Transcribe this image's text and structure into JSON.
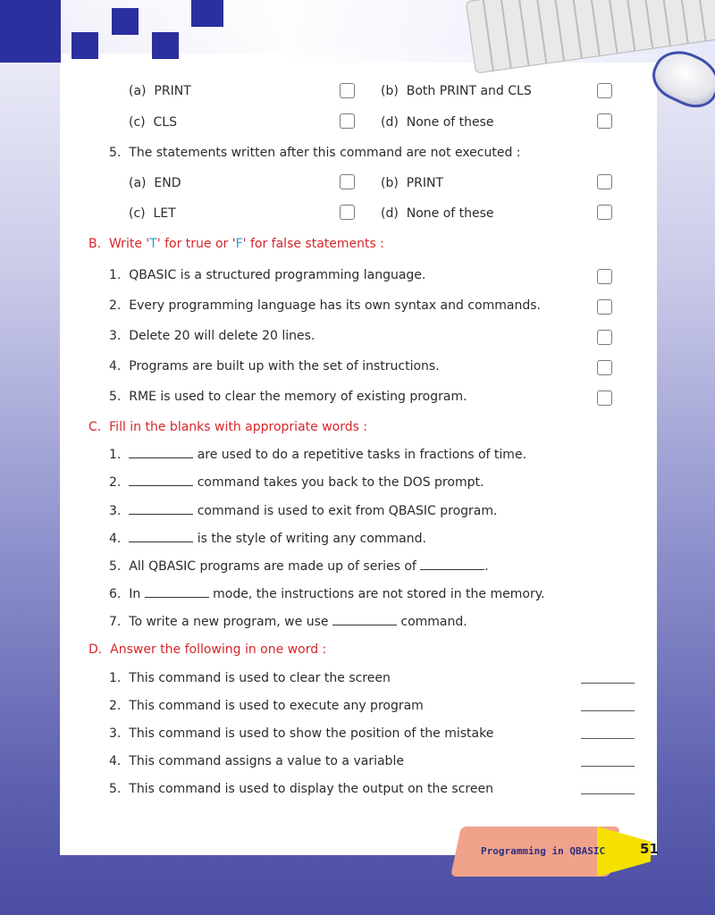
{
  "q4_options": [
    {
      "label": "(a)",
      "text": "PRINT"
    },
    {
      "label": "(b)",
      "text": "Both PRINT and CLS"
    },
    {
      "label": "(c)",
      "text": "CLS"
    },
    {
      "label": "(d)",
      "text": "None of these"
    }
  ],
  "q5": {
    "number": "5.",
    "text": "The statements written after this command are not executed :",
    "options": [
      {
        "label": "(a)",
        "text": "END"
      },
      {
        "label": "(b)",
        "text": "PRINT"
      },
      {
        "label": "(c)",
        "text": "LET"
      },
      {
        "label": "(d)",
        "text": "None of these"
      }
    ]
  },
  "section_b": {
    "letter": "B.",
    "title_pre": "Write '",
    "t": "T",
    "title_mid": "' for true or '",
    "f": "F",
    "title_post": "' for false statements :",
    "items": [
      {
        "num": "1.",
        "text": "QBASIC is a structured programming language."
      },
      {
        "num": "2.",
        "text": "Every programming language has its own syntax and commands."
      },
      {
        "num": "3.",
        "text": "Delete 20 will delete 20 lines."
      },
      {
        "num": "4.",
        "text": "Programs are built up with the set of instructions."
      },
      {
        "num": "5.",
        "text": "RME is used to clear the memory of existing program."
      }
    ]
  },
  "section_c": {
    "letter": "C.",
    "title": "Fill in the blanks with appropriate words :",
    "items": [
      {
        "num": "1.",
        "before": "",
        "after": " are used to do a repetitive tasks in fractions of time."
      },
      {
        "num": "2.",
        "before": "",
        "after": " command takes you back to the DOS prompt."
      },
      {
        "num": "3.",
        "before": "",
        "after": " command is used to exit from QBASIC program."
      },
      {
        "num": "4.",
        "before": "",
        "after": " is the style of writing any command."
      },
      {
        "num": "5.",
        "before": "All QBASIC programs are made up of series of ",
        "after": "."
      },
      {
        "num": "6.",
        "before": "In ",
        "after": " mode, the instructions are not stored in the memory."
      },
      {
        "num": "7.",
        "before": "To write a new program, we use ",
        "after": " command."
      }
    ]
  },
  "section_d": {
    "letter": "D.",
    "title": "Answer the following in one word :",
    "items": [
      {
        "num": "1.",
        "text": "This command is used to clear the screen"
      },
      {
        "num": "2.",
        "text": "This command is used to execute any program"
      },
      {
        "num": "3.",
        "text": "This command is used to show the position of the mistake"
      },
      {
        "num": "4.",
        "text": "This command assigns a value to a variable"
      },
      {
        "num": "5.",
        "text": "This command is used to display the output on the screen"
      }
    ]
  },
  "footer": {
    "chapter": "Programming in QBASIC",
    "page_number": "51"
  },
  "colors": {
    "heading": "#d7262a",
    "tf_letters": "#1a9bd6",
    "corner_squares": "#2c2f9e"
  }
}
